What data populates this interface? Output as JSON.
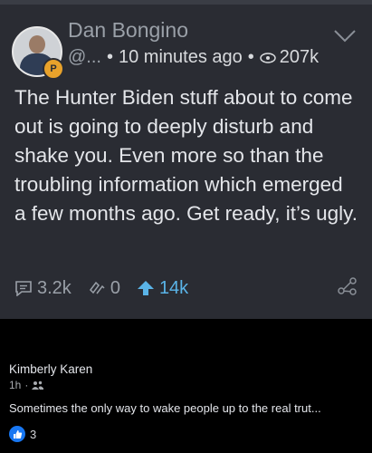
{
  "post": {
    "author": "Dan Bongino",
    "handle": "@...",
    "time": "10 minutes ago",
    "views": "207k",
    "badge_letter": "P",
    "text": "The Hunter Biden stuff about to come out is going to deeply disturb and shake you. Even more so than the troubling information which emerged a few months ago. Get ready, it’s ugly.",
    "comments_count": "3.2k",
    "reposts_count": "0",
    "upvotes_count": "14k",
    "icons": [
      "chevron-down-icon",
      "eye-icon",
      "comment-icon",
      "repost-icon",
      "upvote-icon",
      "share-icon"
    ]
  },
  "comment": {
    "name": "Kimberly Karen",
    "time": "1h",
    "dot": "·",
    "text": "Sometimes the only way to wake people up to the real trut...",
    "like_count": "3",
    "icons": [
      "friends-icon",
      "like-icon"
    ]
  },
  "colors": {
    "card_bg": "#2a2c33",
    "accent_blue": "#5ab4e8",
    "badge_orange": "#e8a22b",
    "fb_blue": "#1877f2"
  }
}
